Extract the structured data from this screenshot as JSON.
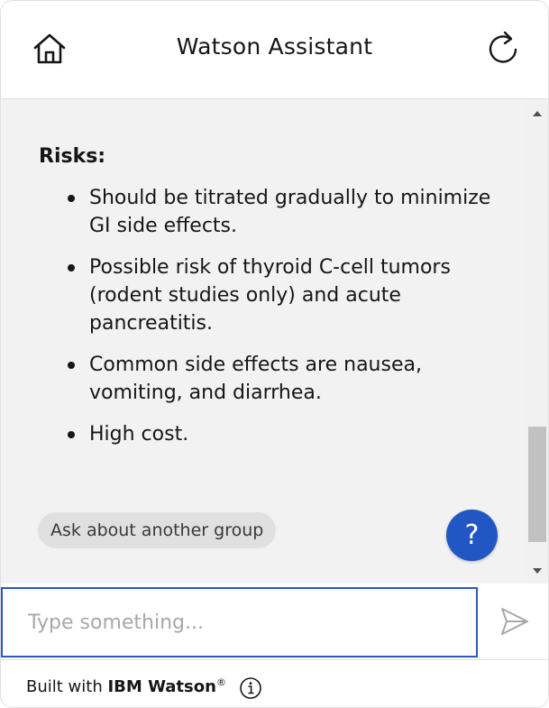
{
  "header": {
    "title": "Watson Assistant",
    "home_icon": "home-icon",
    "restart_icon": "restart-icon"
  },
  "message": {
    "section_title": "Risks:",
    "bullets": [
      "Should be titrated gradually to minimize GI side effects.",
      "Possible risk of thyroid C-cell tumors (rodent studies only) and acute pancreatitis.",
      "Common side effects are nausea, vomiting, and diarrhea.",
      "High cost."
    ],
    "option_chip": "Ask about another group",
    "help_label": "?"
  },
  "input": {
    "placeholder": "Type something...",
    "value": "",
    "send_icon": "send-icon"
  },
  "footer": {
    "prefix": "Built with",
    "brand": "IBM Watson",
    "trademark": "®",
    "info_icon": "info-icon"
  },
  "colors": {
    "accent": "#2256c4",
    "input_border": "#2a5bb8",
    "content_bg": "#f2f2f2",
    "chip_bg": "#e0e0e0"
  }
}
